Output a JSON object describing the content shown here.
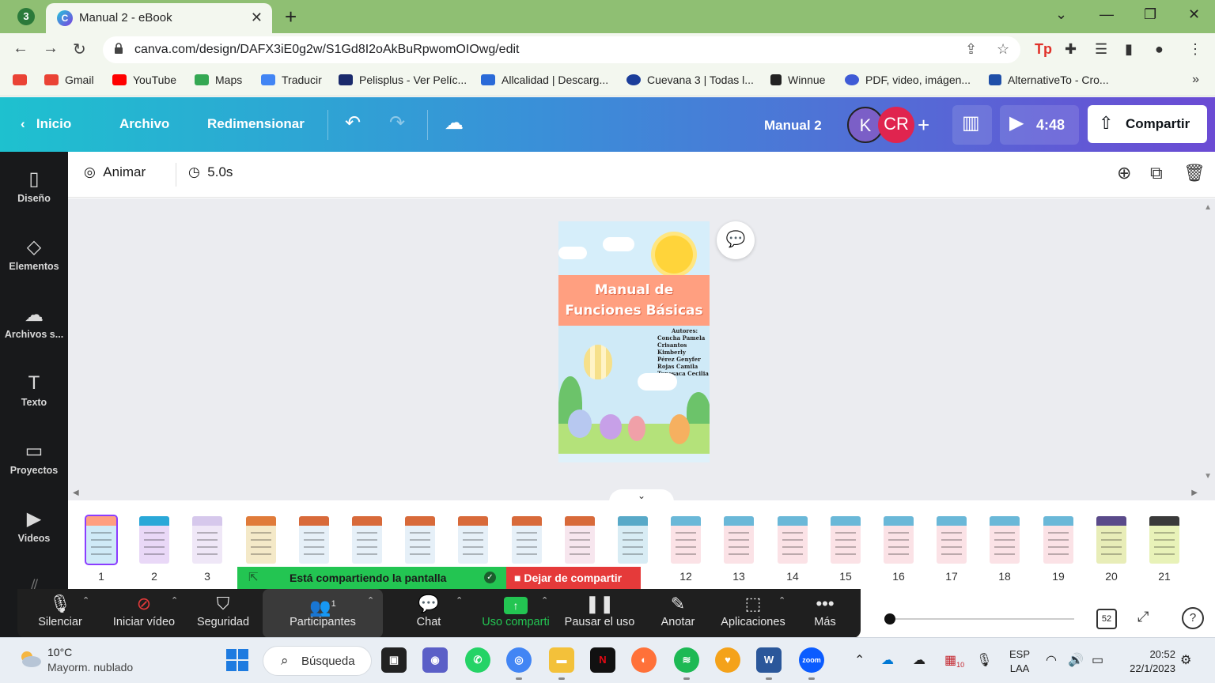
{
  "browser": {
    "tab_title": "Manual 2 - eBook",
    "whatsapp_badge": "3",
    "url": "canva.com/design/DAFX3iE0g2w/S1Gd8I2oAkBuRpwomOIOwg/edit",
    "bookmarks": [
      {
        "label": "Gmail",
        "color": "#ea4335"
      },
      {
        "label": "YouTube",
        "color": "#ff0000"
      },
      {
        "label": "Maps",
        "color": "#34a853"
      },
      {
        "label": "Traducir",
        "color": "#4285f4"
      },
      {
        "label": "Pelisplus - Ver Pelíc...",
        "color": "#1a2a6c"
      },
      {
        "label": "Allcalidad | Descarg...",
        "color": "#2a6ad8"
      },
      {
        "label": "Cuevana 3 | Todas l...",
        "color": "#1b3d9a"
      },
      {
        "label": "Winnue",
        "color": "#222222"
      },
      {
        "label": "PDF, video, imágen...",
        "color": "#3f5bd6"
      },
      {
        "label": "AlternativeTo - Cro...",
        "color": "#1f4fa8"
      }
    ]
  },
  "canva": {
    "header": {
      "home": "Inicio",
      "file": "Archivo",
      "resize": "Redimensionar",
      "doc_name": "Manual 2",
      "avatar_k": "K",
      "avatar_cr": "CR",
      "play_time": "4:48",
      "share": "Compartir"
    },
    "sidebar": [
      {
        "label": "Diseño",
        "icon": "layout-icon",
        "glyph": "▯"
      },
      {
        "label": "Elementos",
        "icon": "shapes-icon",
        "glyph": "◇"
      },
      {
        "label": "Archivos s...",
        "icon": "cloud-upload-icon",
        "glyph": "☁"
      },
      {
        "label": "Texto",
        "icon": "text-icon",
        "glyph": "T"
      },
      {
        "label": "Proyectos",
        "icon": "folder-icon",
        "glyph": "▭"
      },
      {
        "label": "Videos",
        "icon": "video-icon",
        "glyph": "▶"
      }
    ],
    "toolbar": {
      "animate": "Animar",
      "duration": "5.0s"
    },
    "page": {
      "title_line1": "Manual de",
      "title_line2": "Funciones Básicas",
      "authors_heading": "Autores:",
      "authors": [
        "Concha Pamela",
        "Crisantos Kimberly",
        "Pérez Genyfer",
        "Rojas Camila",
        "Tenesaca Cecilia"
      ]
    },
    "thumbnails": [
      {
        "num": "1",
        "color": "#cfeaf7",
        "head": "#ff9f80"
      },
      {
        "num": "2",
        "color": "#e9d8f7",
        "head": "#2aa8d8"
      },
      {
        "num": "3",
        "color": "#efe7f7",
        "head": "#d6c8ec"
      },
      {
        "num": "",
        "color": "#f4e9c8",
        "head": "#e07b3a"
      },
      {
        "num": "",
        "color": "#e6f0f8",
        "head": "#d86a3a"
      },
      {
        "num": "",
        "color": "#e6f0f8",
        "head": "#d86a3a"
      },
      {
        "num": "",
        "color": "#e6f0f8",
        "head": "#d86a3a"
      },
      {
        "num": "",
        "color": "#e6f0f8",
        "head": "#d86a3a"
      },
      {
        "num": "",
        "color": "#e6f0f8",
        "head": "#d86a3a"
      },
      {
        "num": "",
        "color": "#f7e6ee",
        "head": "#d86a3a"
      },
      {
        "num": "",
        "color": "#d8ecf4",
        "head": "#58a9c8"
      },
      {
        "num": "12",
        "color": "#fbe2e6",
        "head": "#6ab8d8"
      },
      {
        "num": "13",
        "color": "#fbe2e6",
        "head": "#6ab8d8"
      },
      {
        "num": "14",
        "color": "#fbe2e6",
        "head": "#6ab8d8"
      },
      {
        "num": "15",
        "color": "#fbe2e6",
        "head": "#6ab8d8"
      },
      {
        "num": "16",
        "color": "#fbe2e6",
        "head": "#6ab8d8"
      },
      {
        "num": "17",
        "color": "#fbe2e6",
        "head": "#6ab8d8"
      },
      {
        "num": "18",
        "color": "#fbe2e6",
        "head": "#6ab8d8"
      },
      {
        "num": "19",
        "color": "#fbe2e6",
        "head": "#6ab8d8"
      },
      {
        "num": "20",
        "color": "#e8edb8",
        "head": "#5a4a8a"
      },
      {
        "num": "21",
        "color": "#e8f2b8",
        "head": "#3a3a3a"
      }
    ],
    "page_count": "52"
  },
  "zoom": {
    "banner_text": "Está compartiendo la pantalla",
    "stop_share": "Dejar de compartir",
    "participants_count": "1",
    "buttons": {
      "mute": "Silenciar",
      "video": "Iniciar vídeo",
      "security": "Seguridad",
      "participants": "Participantes",
      "chat": "Chat",
      "share": "Uso comparti",
      "pause": "Pausar el uso",
      "annotate": "Anotar",
      "apps": "Aplicaciones",
      "more": "Más"
    }
  },
  "taskbar": {
    "temp": "10°C",
    "weather": "Mayorm. nublado",
    "search": "Búsqueda",
    "lang1": "ESP",
    "lang2": "LAA",
    "time": "20:52",
    "date": "22/1/2023",
    "calendar_badge": "10"
  }
}
